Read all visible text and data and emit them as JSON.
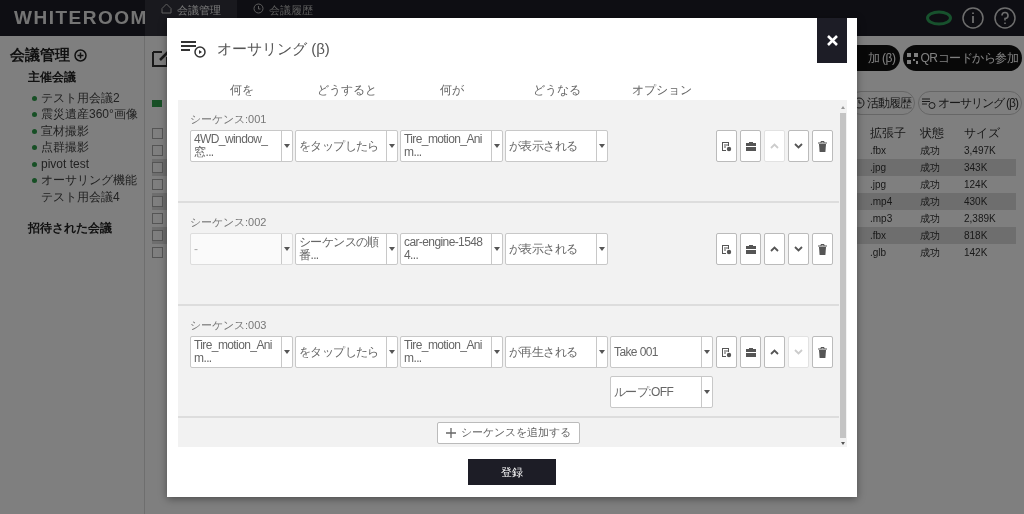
{
  "header": {
    "logo": "WHITEROOM",
    "tabs": [
      {
        "label": "会議管理",
        "selected": true
      },
      {
        "label": "会議履歴",
        "selected": false
      }
    ]
  },
  "sidebar": {
    "title": "会議管理",
    "sections": [
      {
        "title": "主催会議",
        "items": [
          {
            "label": "テスト用会議2",
            "bullet": true
          },
          {
            "label": "震災遺産360°画像",
            "bullet": true
          },
          {
            "label": "宣材撮影",
            "bullet": true
          },
          {
            "label": "点群撮影",
            "bullet": true
          },
          {
            "label": "pivot test",
            "bullet": true
          },
          {
            "label": "オーサリング機能",
            "bullet": true
          },
          {
            "label": "テスト用会議4",
            "bullet": false
          }
        ]
      },
      {
        "title": "招待された会議"
      }
    ]
  },
  "toolbar": {
    "buttons": [
      {
        "label": "加 (β)",
        "kind": "join"
      },
      {
        "label": "QRコードから参加",
        "kind": "qr"
      }
    ],
    "sub_buttons": [
      {
        "label": "活動履歴",
        "kind": "history"
      },
      {
        "label": "オーサリング (β)",
        "kind": "authoring"
      }
    ]
  },
  "file_table": {
    "all_checked": false,
    "columns": [
      "拡張子",
      "状態",
      "サイズ"
    ],
    "rows": [
      {
        "checked": false,
        "cells": [
          ".fbx",
          "成功",
          "3,497K"
        ]
      },
      {
        "checked": false,
        "cells": [
          ".jpg",
          "成功",
          "343K"
        ]
      },
      {
        "checked": false,
        "cells": [
          ".jpg",
          "成功",
          "124K"
        ]
      },
      {
        "checked": false,
        "cells": [
          ".mp4",
          "成功",
          "430K"
        ]
      },
      {
        "checked": false,
        "cells": [
          ".mp3",
          "成功",
          "2,389K"
        ]
      },
      {
        "checked": false,
        "cells": [
          ".fbx",
          "成功",
          "818K"
        ]
      },
      {
        "checked": false,
        "cells": [
          ".glb",
          "成功",
          "142K"
        ]
      }
    ]
  },
  "modal": {
    "title": "オーサリング (β)",
    "columns": [
      "何を",
      "どうすると",
      "何が",
      "どうなる",
      "オプション"
    ],
    "sequences": [
      {
        "label": "シーケンス:001",
        "fields": [
          {
            "value": "4WD_window_窓...",
            "disabled": false
          },
          {
            "value": "をタップしたら",
            "disabled": false
          },
          {
            "value": "Tire_motion_Anim...",
            "disabled": false
          },
          {
            "value": "が表示される",
            "disabled": false
          }
        ],
        "actions": [
          {
            "kind": "note",
            "disabled": false
          },
          {
            "kind": "toolbox",
            "disabled": false
          },
          {
            "kind": "up",
            "disabled": true
          },
          {
            "kind": "down",
            "disabled": false
          },
          {
            "kind": "delete",
            "disabled": false
          }
        ]
      },
      {
        "label": "シーケンス:002",
        "fields": [
          {
            "value": "-",
            "disabled": true
          },
          {
            "value": "シーケンスの順番...",
            "disabled": false
          },
          {
            "value": "car-engine-15484...",
            "disabled": false
          },
          {
            "value": "が表示される",
            "disabled": false
          }
        ],
        "actions": [
          {
            "kind": "note",
            "disabled": false
          },
          {
            "kind": "toolbox",
            "disabled": false
          },
          {
            "kind": "up",
            "disabled": false
          },
          {
            "kind": "down",
            "disabled": false
          },
          {
            "kind": "delete",
            "disabled": false
          }
        ]
      },
      {
        "label": "シーケンス:003",
        "fields": [
          {
            "value": "Tire_motion_Anim...",
            "disabled": false
          },
          {
            "value": "をタップしたら",
            "disabled": false
          },
          {
            "value": "Tire_motion_Anim...",
            "disabled": false
          },
          {
            "value": "が再生される",
            "disabled": false
          }
        ],
        "options": [
          {
            "value": "Take 001",
            "disabled": false
          },
          {
            "value": "ループ:OFF",
            "disabled": false
          }
        ],
        "actions": [
          {
            "kind": "note",
            "disabled": false
          },
          {
            "kind": "toolbox",
            "disabled": false
          },
          {
            "kind": "up",
            "disabled": false
          },
          {
            "kind": "down",
            "disabled": true
          },
          {
            "kind": "delete",
            "disabled": false
          }
        ]
      }
    ],
    "add_button": "シーケンスを追加する",
    "submit_button": "登録"
  }
}
